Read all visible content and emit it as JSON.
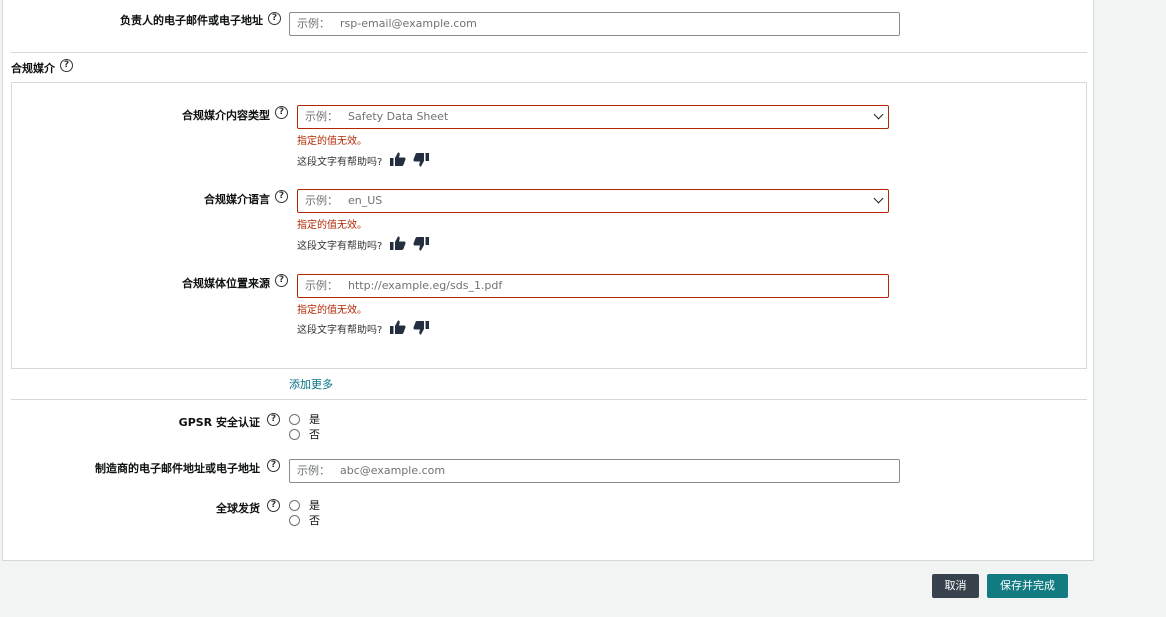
{
  "responsible_email": {
    "label": "负责人的电子邮件或电子地址",
    "placeholder_prefix": "示例：",
    "placeholder_value": "rsp-email@example.com"
  },
  "compliance_media": {
    "section_label": "合规媒介",
    "content_type": {
      "label": "合规媒介内容类型",
      "placeholder_prefix": "示例：",
      "placeholder_value": "Safety Data Sheet",
      "error": "指定的值无效。",
      "helpful_prompt": "这段文字有帮助吗?"
    },
    "language": {
      "label": "合规媒介语言",
      "placeholder_prefix": "示例：",
      "placeholder_value": "en_US",
      "error": "指定的值无效。",
      "helpful_prompt": "这段文字有帮助吗?"
    },
    "location_source": {
      "label": "合规媒体位置来源",
      "placeholder_prefix": "示例：",
      "placeholder_value": "http://example.eg/sds_1.pdf",
      "error": "指定的值无效。",
      "helpful_prompt": "这段文字有帮助吗?"
    },
    "add_more": "添加更多"
  },
  "gpsr": {
    "label": "GPSR 安全认证",
    "options": [
      "是",
      "否"
    ]
  },
  "manufacturer_email": {
    "label": "制造商的电子邮件地址或电子地址",
    "placeholder_prefix": "示例：",
    "placeholder_value": "abc@example.com"
  },
  "global_shipping": {
    "label": "全球发货",
    "options": [
      "是",
      "否"
    ]
  },
  "actions": {
    "cancel": "取消",
    "save_finish": "保存并完成"
  },
  "colors": {
    "error": "#b12704",
    "primary_button": "#127b82",
    "secondary_button": "#37424d",
    "link": "#007185"
  },
  "icons": {
    "help": "question-circle-icon",
    "thumbs_up": "thumbs-up-icon",
    "thumbs_down": "thumbs-down-icon",
    "dropdown": "chevron-down-icon"
  }
}
